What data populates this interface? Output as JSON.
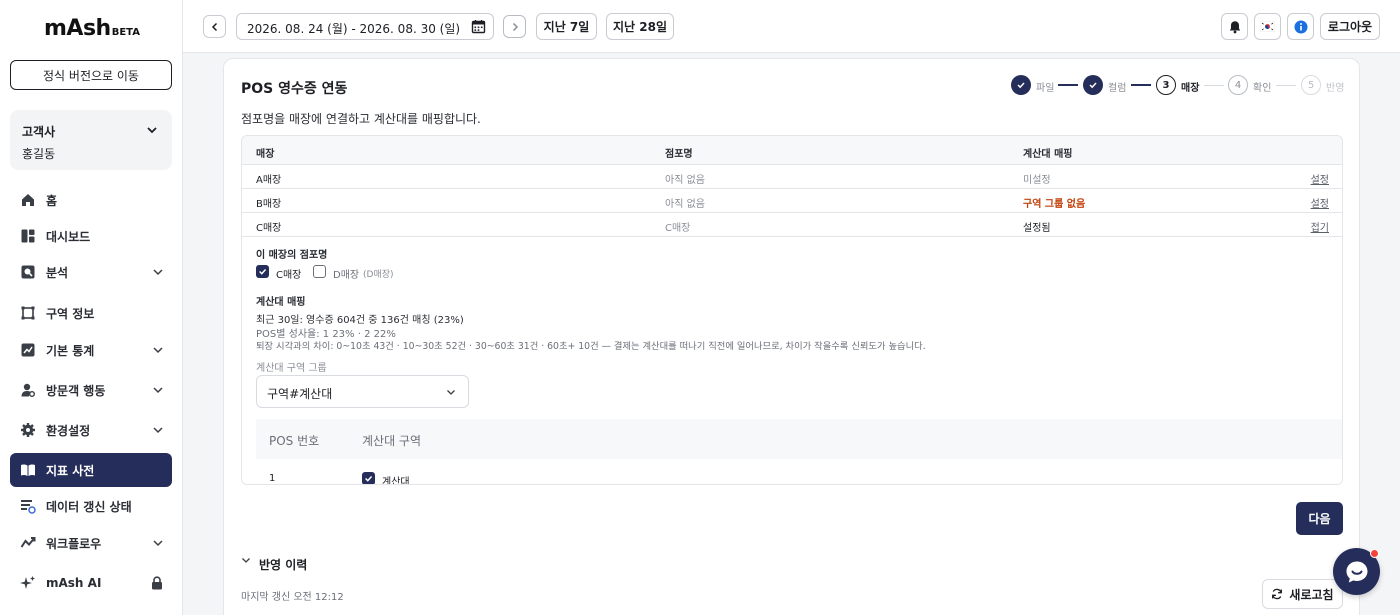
{
  "brand": {
    "logo": "mAsh",
    "badge": "BETA"
  },
  "sidebar": {
    "official_button": "정식 버전으로 이동",
    "client": {
      "label": "고객사",
      "name": "홍길동"
    },
    "items": [
      {
        "label": "홈",
        "icon": "home-icon"
      },
      {
        "label": "대시보드",
        "icon": "dashboard-icon"
      },
      {
        "label": "분석",
        "icon": "analysis-icon"
      },
      {
        "label": "구역 정보",
        "icon": "zone-icon"
      },
      {
        "label": "기본 통계",
        "icon": "stats-icon"
      },
      {
        "label": "방문객 행동",
        "icon": "visitor-icon"
      },
      {
        "label": "환경설정",
        "icon": "settings-icon"
      },
      {
        "label": "지표 사전",
        "icon": "book-icon"
      },
      {
        "label": "데이터 갱신 상태",
        "icon": "data-status-icon"
      },
      {
        "label": "워크플로우",
        "icon": "workflow-icon"
      },
      {
        "label": "mAsh AI",
        "icon": "sparkle-icon"
      }
    ]
  },
  "topbar": {
    "date_range": "2026. 08. 24 (월) - 2026. 08. 30 (일)",
    "range_7": "지난 7일",
    "range_28": "지난 28일",
    "logout": "로그아웃"
  },
  "card": {
    "title": "POS 영수증 연동",
    "description": "점포명을 매장에 연결하고 계산대를 매핑합니다.",
    "steps": [
      {
        "num": "1",
        "label": "파일",
        "state": "done"
      },
      {
        "num": "2",
        "label": "컬럼",
        "state": "done"
      },
      {
        "num": "3",
        "label": "매장",
        "state": "current"
      },
      {
        "num": "4",
        "label": "확인",
        "state": "todo"
      },
      {
        "num": "5",
        "label": "반영",
        "state": "todo"
      }
    ],
    "table": {
      "headers": [
        "매장",
        "점포명",
        "계산대 매핑"
      ],
      "rows": [
        {
          "store": "A매장",
          "branch": "아직 없음",
          "mapping": "미설정",
          "action": "설정"
        },
        {
          "store": "B매장",
          "branch": "아직 없음",
          "mapping": "구역 그룹 없음",
          "action": "설정"
        },
        {
          "store": "C매장",
          "branch": "C매장",
          "mapping": "설정됨",
          "action": "접기"
        }
      ]
    },
    "detail": {
      "branch_section": "이 매장의 점포명",
      "branch_options": [
        {
          "label": "C매장",
          "sub": "",
          "checked": true
        },
        {
          "label": "D매장",
          "sub": "(D매장)",
          "checked": false
        }
      ],
      "mapping_section": "계산대 매핑",
      "summary": "최근 30일: 영수증 604건 중 136건 매칭 (23%)",
      "success_rate": "POS별 성사율: 1 23% · 2 22%",
      "time_diff": "퇴장 시각과의 차이: 0~10초 43건 · 10~30초 52건 · 30~60초 31건 · 60초+ 10건 — 결제는 계산대를 떠나기 직전에 일어나므로, 차이가 작을수록 신뢰도가 높습니다.",
      "group_label": "계산대 구역 그룹",
      "group_value": "구역#계산대",
      "pos_headers": [
        "POS 번호",
        "계산대 구역"
      ],
      "pos_rows": [
        {
          "num": "1",
          "zone": "계산대",
          "checked": true
        }
      ]
    },
    "next_button": "다음",
    "history": {
      "title": "반영 이력",
      "last_update": "마지막 갱신 오전 12:12",
      "refresh": "새로고침"
    }
  },
  "colors": {
    "primary": "#252e5a",
    "warning": "#c2410c",
    "notification": "#f0443a"
  }
}
